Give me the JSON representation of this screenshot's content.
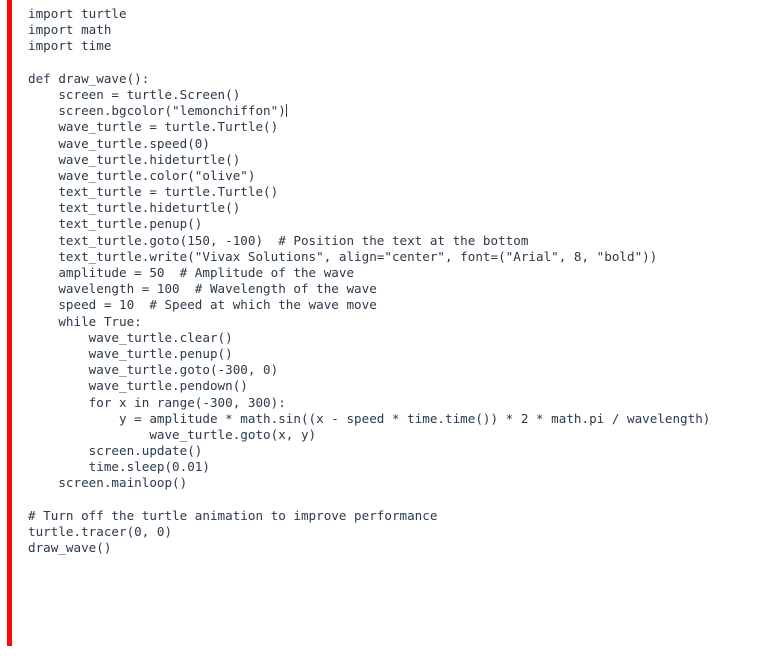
{
  "editor": {
    "background_color": "#ffffff",
    "text_color": "#2b3a4a",
    "accent_bar_color": "#fb0808",
    "language": "python",
    "caret_line_index": 6,
    "caret_after_text": "        wave_turtle = turtle.Turtle()"
  },
  "code": {
    "lines": [
      "import turtle",
      "import math",
      "import time",
      "",
      "def draw_wave():",
      "    screen = turtle.Screen()",
      "    screen.bgcolor(\"lemonchiffon\")",
      "    wave_turtle = turtle.Turtle()",
      "    wave_turtle.speed(0)",
      "    wave_turtle.hideturtle()",
      "    wave_turtle.color(\"olive\")",
      "    text_turtle = turtle.Turtle()",
      "    text_turtle.hideturtle()",
      "    text_turtle.penup()",
      "    text_turtle.goto(150, -100)  # Position the text at the bottom",
      "    text_turtle.write(\"Vivax Solutions\", align=\"center\", font=(\"Arial\", 8, \"bold\"))",
      "    amplitude = 50  # Amplitude of the wave",
      "    wavelength = 100  # Wavelength of the wave",
      "    speed = 10  # Speed at which the wave move",
      "    while True:",
      "        wave_turtle.clear()",
      "        wave_turtle.penup()",
      "        wave_turtle.goto(-300, 0)",
      "        wave_turtle.pendown()",
      "        for x in range(-300, 300):",
      "            y = amplitude * math.sin((x - speed * time.time()) * 2 * math.pi / wavelength)",
      "                wave_turtle.goto(x, y)",
      "        screen.update()",
      "        time.sleep(0.01)",
      "    screen.mainloop()",
      "",
      "# Turn off the turtle animation to improve performance",
      "turtle.tracer(0, 0)",
      "draw_wave()"
    ]
  }
}
